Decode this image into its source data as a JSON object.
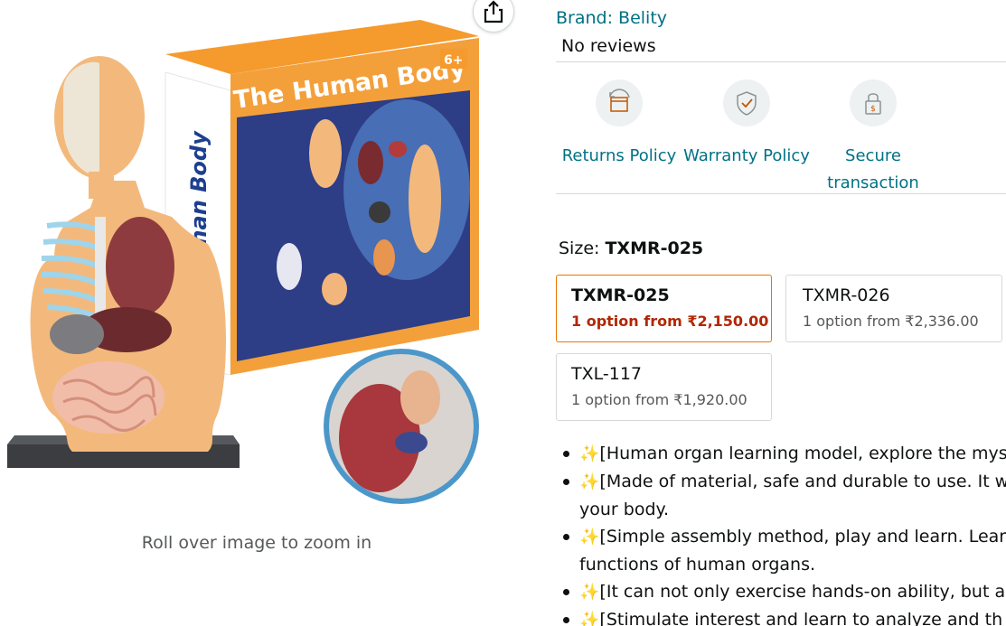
{
  "gallery": {
    "share_icon": "share-icon",
    "zoom_hint": "Roll over image to zoom in",
    "box_title": "The Human Body",
    "box_spine_text": "The Human Body",
    "age_badge": "6+",
    "colors": {
      "box_orange": "#f59a2d",
      "box_blue": "#1d3f8f",
      "skin": "#f3b97c"
    }
  },
  "product": {
    "brand": "Brand: Belity",
    "reviews": "No reviews"
  },
  "badges": [
    {
      "icon": "returns-box-icon",
      "label": "Returns Policy"
    },
    {
      "icon": "warranty-shield-icon",
      "label": "Warranty Policy"
    },
    {
      "icon": "secure-lock-icon",
      "label": "Secure transaction"
    }
  ],
  "size": {
    "label": "Size: ",
    "selected": "TXMR-025",
    "options": [
      {
        "name": "TXMR-025",
        "price": "1 option from ₹2,150.00",
        "selected": true
      },
      {
        "name": "TXMR-026",
        "price": "1 option from ₹2,336.00",
        "selected": false
      },
      {
        "name": "TXL-117",
        "price": "1 option from ₹1,920.00",
        "selected": false
      }
    ]
  },
  "bullets": [
    {
      "emoji": "sparkle-icon",
      "text": "[Human organ learning model, explore the mys"
    },
    {
      "emoji": "sparkle-icon",
      "text": "[Made of material, safe and durable to use. It w"
    },
    {
      "emoji": "",
      "text": "your body."
    },
    {
      "emoji": "sparkle-icon",
      "text": "[Simple assembly method, play and learn. Lear"
    },
    {
      "emoji": "",
      "text": "functions of human organs."
    },
    {
      "emoji": "sparkle-icon",
      "text": "[It can not only exercise hands-on ability, but a"
    },
    {
      "emoji": "sparkle-icon",
      "text": "[Stimulate interest and learn to analyze and th"
    }
  ],
  "colors": {
    "link": "#007185",
    "price_red": "#b12704",
    "selected_border": "#e77600",
    "muted": "#565959"
  }
}
